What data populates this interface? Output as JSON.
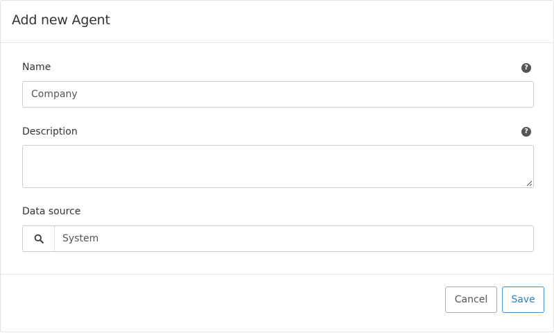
{
  "dialog": {
    "title": "Add new Agent"
  },
  "form": {
    "name": {
      "label": "Name",
      "value": "Company",
      "help_icon": "question-circle-icon"
    },
    "description": {
      "label": "Description",
      "value": "",
      "help_icon": "question-circle-icon"
    },
    "data_source": {
      "label": "Data source",
      "value": "System",
      "icon": "search-icon"
    }
  },
  "footer": {
    "cancel_label": "Cancel",
    "save_label": "Save"
  },
  "colors": {
    "primary": "#2a7fca",
    "border": "#cccccc",
    "text": "#333333"
  }
}
